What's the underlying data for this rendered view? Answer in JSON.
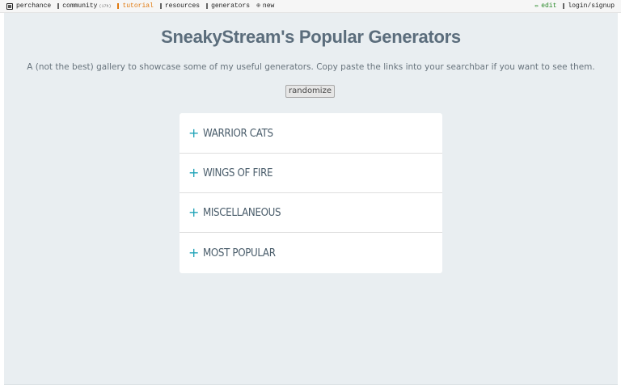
{
  "topbar": {
    "left": [
      {
        "name": "perchance",
        "label": "perchance",
        "icon": "die-icon"
      },
      {
        "name": "community",
        "label": "community",
        "icon": "chat-icon",
        "badge": "(17h)"
      },
      {
        "name": "tutorial",
        "label": "tutorial",
        "icon": "book-icon"
      },
      {
        "name": "resources",
        "label": "resources",
        "icon": "box-icon"
      },
      {
        "name": "generators",
        "label": "generators",
        "icon": "list-icon"
      },
      {
        "name": "new",
        "label": "new",
        "icon": "plus-circle-icon"
      }
    ],
    "right": [
      {
        "name": "edit",
        "label": "edit",
        "icon": "pencil-icon"
      },
      {
        "name": "login",
        "label": "login/signup",
        "icon": "user-icon"
      }
    ]
  },
  "page": {
    "title": "SneakyStream's Popular Generators",
    "description": "A (not the best) gallery to showcase some of my useful generators. Copy paste the links into your searchbar if you want to see them.",
    "randomize_label": "randomize"
  },
  "accordion": {
    "items": [
      {
        "label": "WARRIOR CATS"
      },
      {
        "label": "WINGS OF FIRE"
      },
      {
        "label": "MISCELLANEOUS"
      },
      {
        "label": "MOST POPULAR"
      }
    ],
    "expand_symbol": "+"
  },
  "colors": {
    "page_bg": "#e9eef1",
    "title": "#5b6d7c",
    "accent": "#1fa3b8",
    "tutorial_link": "#e07a10",
    "edit_link": "#2a8a2a"
  }
}
